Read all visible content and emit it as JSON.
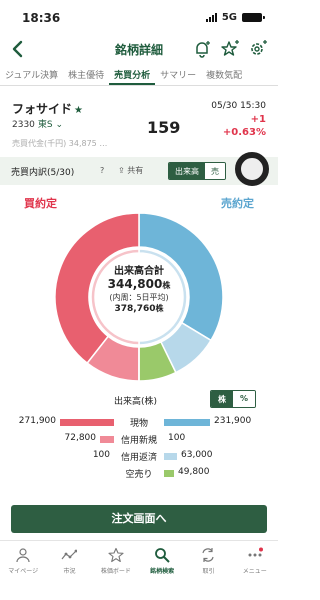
{
  "status": {
    "time": "18:36",
    "network": "5G"
  },
  "nav": {
    "title": "銘柄詳細"
  },
  "tabs": [
    "ジュアル決算",
    "株主優待",
    "売買分析",
    "サマリー",
    "複数気配"
  ],
  "stock": {
    "name": "フォサイド",
    "code": "2330",
    "market": "東S",
    "time": "05/30 15:30",
    "price": "159",
    "change": "+1",
    "change_pct": "+0.63%",
    "hidden_row": "売買代金(千円)      34,875      …"
  },
  "section": {
    "title": "売買内訳(5/30)",
    "help": "?",
    "share": "共有",
    "toggle_active": "出来高",
    "toggle_other": "売"
  },
  "donut": {
    "buy_label": "買約定",
    "sell_label": "売約定",
    "center_title": "出来高合計",
    "total": "344,800",
    "unit": "株",
    "sub": "(内周：5日平均)",
    "avg": "378,760",
    "avg_unit": "株"
  },
  "volume": {
    "label": "出来高(株)",
    "unit_active": "株",
    "unit_other": "%"
  },
  "chart_data": {
    "type": "table",
    "total": 344800,
    "five_day_average": 378760,
    "rows": [
      {
        "category": "現物",
        "buy": "271,900",
        "sell": "231,900",
        "buy_value": 271900,
        "sell_value": 231900
      },
      {
        "category": "信用新規",
        "buy": "72,800",
        "sell": "100",
        "buy_value": 72800,
        "sell_value": 100
      },
      {
        "category": "信用返済",
        "buy": "100",
        "sell": "63,000",
        "buy_value": 100,
        "sell_value": 63000
      },
      {
        "category": "空売り",
        "buy": "",
        "sell": "49,800",
        "buy_value": 0,
        "sell_value": 49800
      }
    ]
  },
  "colors": {
    "buy": "#e8606f",
    "buy_light": "#f08a97",
    "sell": "#6eb5d8",
    "sell_light": "#b7d8ea",
    "short": "#9ac96a",
    "accent": "#2e5e42"
  },
  "order_button": "注文画面へ",
  "tabbar": [
    {
      "label": "マイページ",
      "icon": "person-icon"
    },
    {
      "label": "市況",
      "icon": "market-icon"
    },
    {
      "label": "株価ボード",
      "icon": "star-icon"
    },
    {
      "label": "銘柄検索",
      "icon": "search-icon",
      "active": true
    },
    {
      "label": "取引",
      "icon": "trade-icon"
    },
    {
      "label": "メニュー",
      "icon": "menu-icon"
    }
  ]
}
